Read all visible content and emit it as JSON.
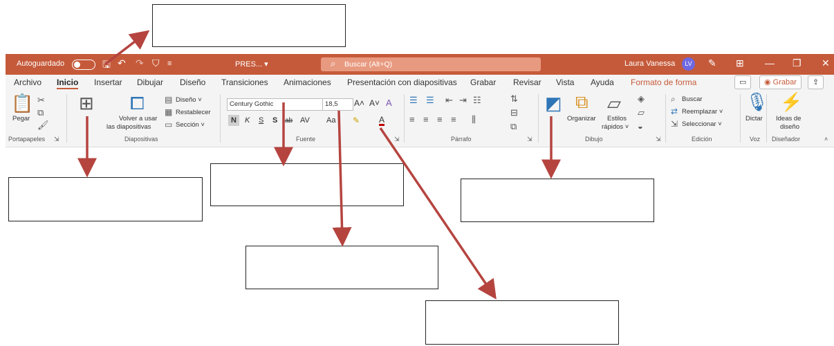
{
  "titlebar": {
    "autosave_label": "Autoguardado",
    "filename": "PRES... ▾",
    "search_placeholder": "Buscar (Alt+Q)",
    "user_name": "Laura Vanessa",
    "user_initials": "LV"
  },
  "tabs": [
    "Archivo",
    "Inicio",
    "Insertar",
    "Dibujar",
    "Diseño",
    "Transiciones",
    "Animaciones",
    "Presentación con diapositivas",
    "Grabar",
    "Revisar",
    "Vista",
    "Ayuda",
    "Formato de forma"
  ],
  "active_tab": "Inicio",
  "record_button": "Grabar",
  "ribbon": {
    "portapapeles": {
      "paste": "Pegar",
      "label": "Portapapeles"
    },
    "diapositivas": {
      "reuse_line1": "Volver a usar",
      "reuse_line2": "las diapositivas",
      "layout": "Diseño ˅",
      "reset": "Restablecer",
      "section": "Sección ˅",
      "label": "Diapositivas"
    },
    "fuente": {
      "font_name": "Century Gothic",
      "font_size": "18,5",
      "bold": "N",
      "italic": "K",
      "underline": "S",
      "strike": "S",
      "shadow": "ab",
      "spacing": "AV",
      "case": "Aa",
      "label": "Fuente"
    },
    "parrafo": {
      "label": "Párrafo"
    },
    "dibujo": {
      "arrange": "Organizar",
      "styles_line1": "Estilos",
      "styles_line2": "rápidos ˅",
      "label": "Dibujo"
    },
    "edicion": {
      "find": "Buscar",
      "replace": "Reemplazar ˅",
      "select": "Seleccionar ˅",
      "label": "Edición"
    },
    "voz": {
      "dictate": "Dictar",
      "label": "Voz"
    },
    "disenador": {
      "ideas_line1": "Ideas de",
      "ideas_line2": "diseño",
      "label": "Diseñador"
    }
  },
  "colors": {
    "accent": "#c55a3a",
    "arrow": "#b5443f"
  }
}
